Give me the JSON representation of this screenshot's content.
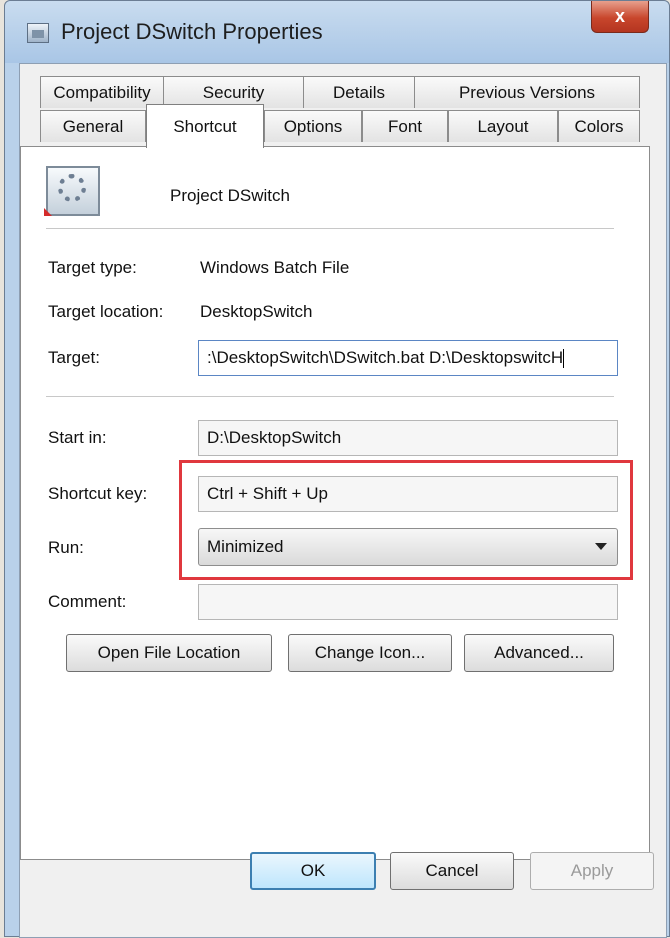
{
  "window": {
    "title": "Project DSwitch Properties",
    "close_label": "x"
  },
  "tabs_row1": [
    "Compatibility",
    "Security",
    "Details",
    "Previous Versions"
  ],
  "tabs_row2": [
    "General",
    "Shortcut",
    "Options",
    "Font",
    "Layout",
    "Colors"
  ],
  "active_tab": "Shortcut",
  "shortcut": {
    "name": "Project DSwitch",
    "target_type_label": "Target type:",
    "target_type": "Windows Batch File",
    "target_location_label": "Target location:",
    "target_location": "DesktopSwitch",
    "target_label": "Target:",
    "target_value": ":\\DesktopSwitch\\DSwitch.bat D:\\DesktopswitcH",
    "start_in_label": "Start in:",
    "start_in": "D:\\DesktopSwitch",
    "shortcut_key_label": "Shortcut key:",
    "shortcut_key": "Ctrl + Shift + Up",
    "run_label": "Run:",
    "run": "Minimized",
    "comment_label": "Comment:",
    "comment": ""
  },
  "actions": {
    "open_file_location": "Open File Location",
    "change_icon": "Change Icon...",
    "advanced": "Advanced..."
  },
  "footer": {
    "ok": "OK",
    "cancel": "Cancel",
    "apply": "Apply"
  },
  "colors": {
    "highlight": "#e0383e",
    "accent": "#3c7fb1"
  }
}
